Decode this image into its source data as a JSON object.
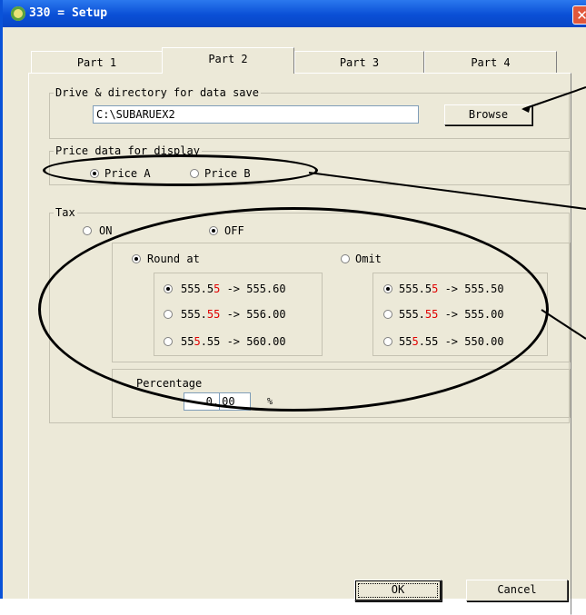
{
  "window": {
    "title": "330 = Setup",
    "close_icon": "close-icon",
    "app_icon": "app-icon"
  },
  "tabs": [
    {
      "label": "Part 1",
      "active": false
    },
    {
      "label": "Part 2",
      "active": true
    },
    {
      "label": "Part 3",
      "active": false
    },
    {
      "label": "Part 4",
      "active": false
    }
  ],
  "drive": {
    "group_label": "Drive & directory for data save",
    "path_value": "C:\\SUBARUEX2",
    "browse_label": "Browse"
  },
  "price": {
    "group_label": "Price data for display",
    "option_a": "Price A",
    "option_b": "Price B",
    "selected": "Price A"
  },
  "tax": {
    "group_label": "Tax",
    "on_label": "ON",
    "off_label": "OFF",
    "selected": "OFF",
    "round_label": "Round at",
    "omit_label": "Omit",
    "round_options": [
      {
        "pre": "555.5",
        "red": "5",
        "post": " -> 555.60",
        "selected": true
      },
      {
        "pre": "555.",
        "red": "55",
        "post": " -> 556.00",
        "selected": false
      },
      {
        "pre": "55",
        "red": "5",
        "post": ".55 -> 560.00",
        "selected": false
      }
    ],
    "omit_options": [
      {
        "pre": "555.5",
        "red": "5",
        "post": " -> 555.50",
        "selected": true
      },
      {
        "pre": "555.",
        "red": "55",
        "post": " -> 555.00",
        "selected": false
      },
      {
        "pre": "55",
        "red": "5",
        "post": ".55 -> 550.00",
        "selected": false
      }
    ],
    "percentage_label": "Percentage",
    "percentage_int": "0",
    "percentage_dec": "00",
    "percent_sign": "%"
  },
  "buttons": {
    "ok_label": "OK",
    "cancel_label": "Cancel"
  }
}
